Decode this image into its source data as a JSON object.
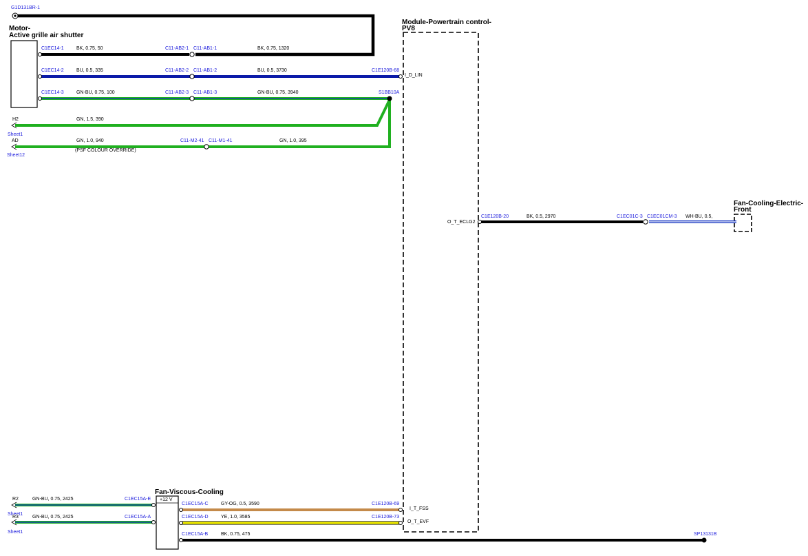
{
  "colors": {
    "bk": "#000000",
    "bu": "#0b1aa8",
    "gn": "#20b020",
    "gnbu_green": "#20b020",
    "gnbu_blue": "#1030c0",
    "gyog": "#c48a4a",
    "ye": "#f2ee00",
    "whbu_blue": "#1030c0",
    "ref_text": "#1a1adc"
  },
  "components": {
    "motor": {
      "line1": "Motor-",
      "line2": "Active grille air shutter"
    },
    "pcm": {
      "line1": "Module-Powertrain control-",
      "line2": "PV8"
    },
    "fan_front": {
      "line1": "Fan-Cooling-Electric-",
      "line2": "Front"
    },
    "fan_viscous": {
      "title": "Fan-Viscous-Cooling",
      "pin": "+12 V"
    }
  },
  "ground": {
    "label": "G1D131BR-1"
  },
  "pins": {
    "lin": "I_D_LIN",
    "eclg2": "O_T_ECLG2",
    "fss": "I_T_FSS",
    "evf": "O_T_EVF"
  },
  "wires": {
    "w1": {
      "c1": "C1EC14-1",
      "spec1": "BK,  0.75,  50",
      "c2": "C11-AB2-1",
      "c3": "C11-AB1-1",
      "spec2": "BK,  0.75,  1320"
    },
    "w2": {
      "c1": "C1EC14-2",
      "spec1": "BU,  0.5,  335",
      "c2": "C11-AB2-2",
      "c3": "C11-AB1-2",
      "spec2": "BU,  0.5,  3730",
      "c4": "C1E120B-68"
    },
    "w3": {
      "c1": "C1EC14-3",
      "spec1": "GN-BU,  0.75,  100",
      "c2": "C11-AB2-3",
      "c3": "C11-AB1-3",
      "spec2": "GN-BU,  0.75,  3940",
      "splice": "S1BB10A"
    },
    "w4": {
      "ref": "H2",
      "sheet": "Sheet1",
      "spec": "GN,  1.5,  390"
    },
    "w5": {
      "ref": "AD",
      "sheet": "Sheet12",
      "spec1": "GN,  1.0,  940",
      "note": "(PSF COLOUR OVERRIDE)",
      "c1": "C11-M2-41",
      "c2": "C11-M1-41",
      "spec2": "GN,  1.0,  395"
    },
    "w6": {
      "c1": "C1E120B-20",
      "spec": "BK,  0.5,  2970",
      "c2": "C1EC01C-3",
      "c3": "C1EC01CM-3",
      "spec2": "WH-BU,  0.5,"
    },
    "w7": {
      "ref": "R2",
      "sheet": "Sheet1",
      "spec": "GN-BU,  0.75,  2425",
      "c1": "C1EC15A-E"
    },
    "w8": {
      "ref": "R3",
      "sheet": "Sheet1",
      "spec": "GN-BU,  0.75,  2425",
      "c1": "C1EC15A-A"
    },
    "w9": {
      "c1": "C1EC15A-C",
      "spec": "GY-OG,  0.5,  3590",
      "c2": "C1E120B-69"
    },
    "w10": {
      "c1": "C1EC15A-D",
      "spec": "YE,  1.0,  3585",
      "c2": "C1E120B-73"
    },
    "w11": {
      "c1": "C1EC15A-B",
      "spec": "BK,  0.75,  475",
      "splice": "SP13131B"
    }
  }
}
